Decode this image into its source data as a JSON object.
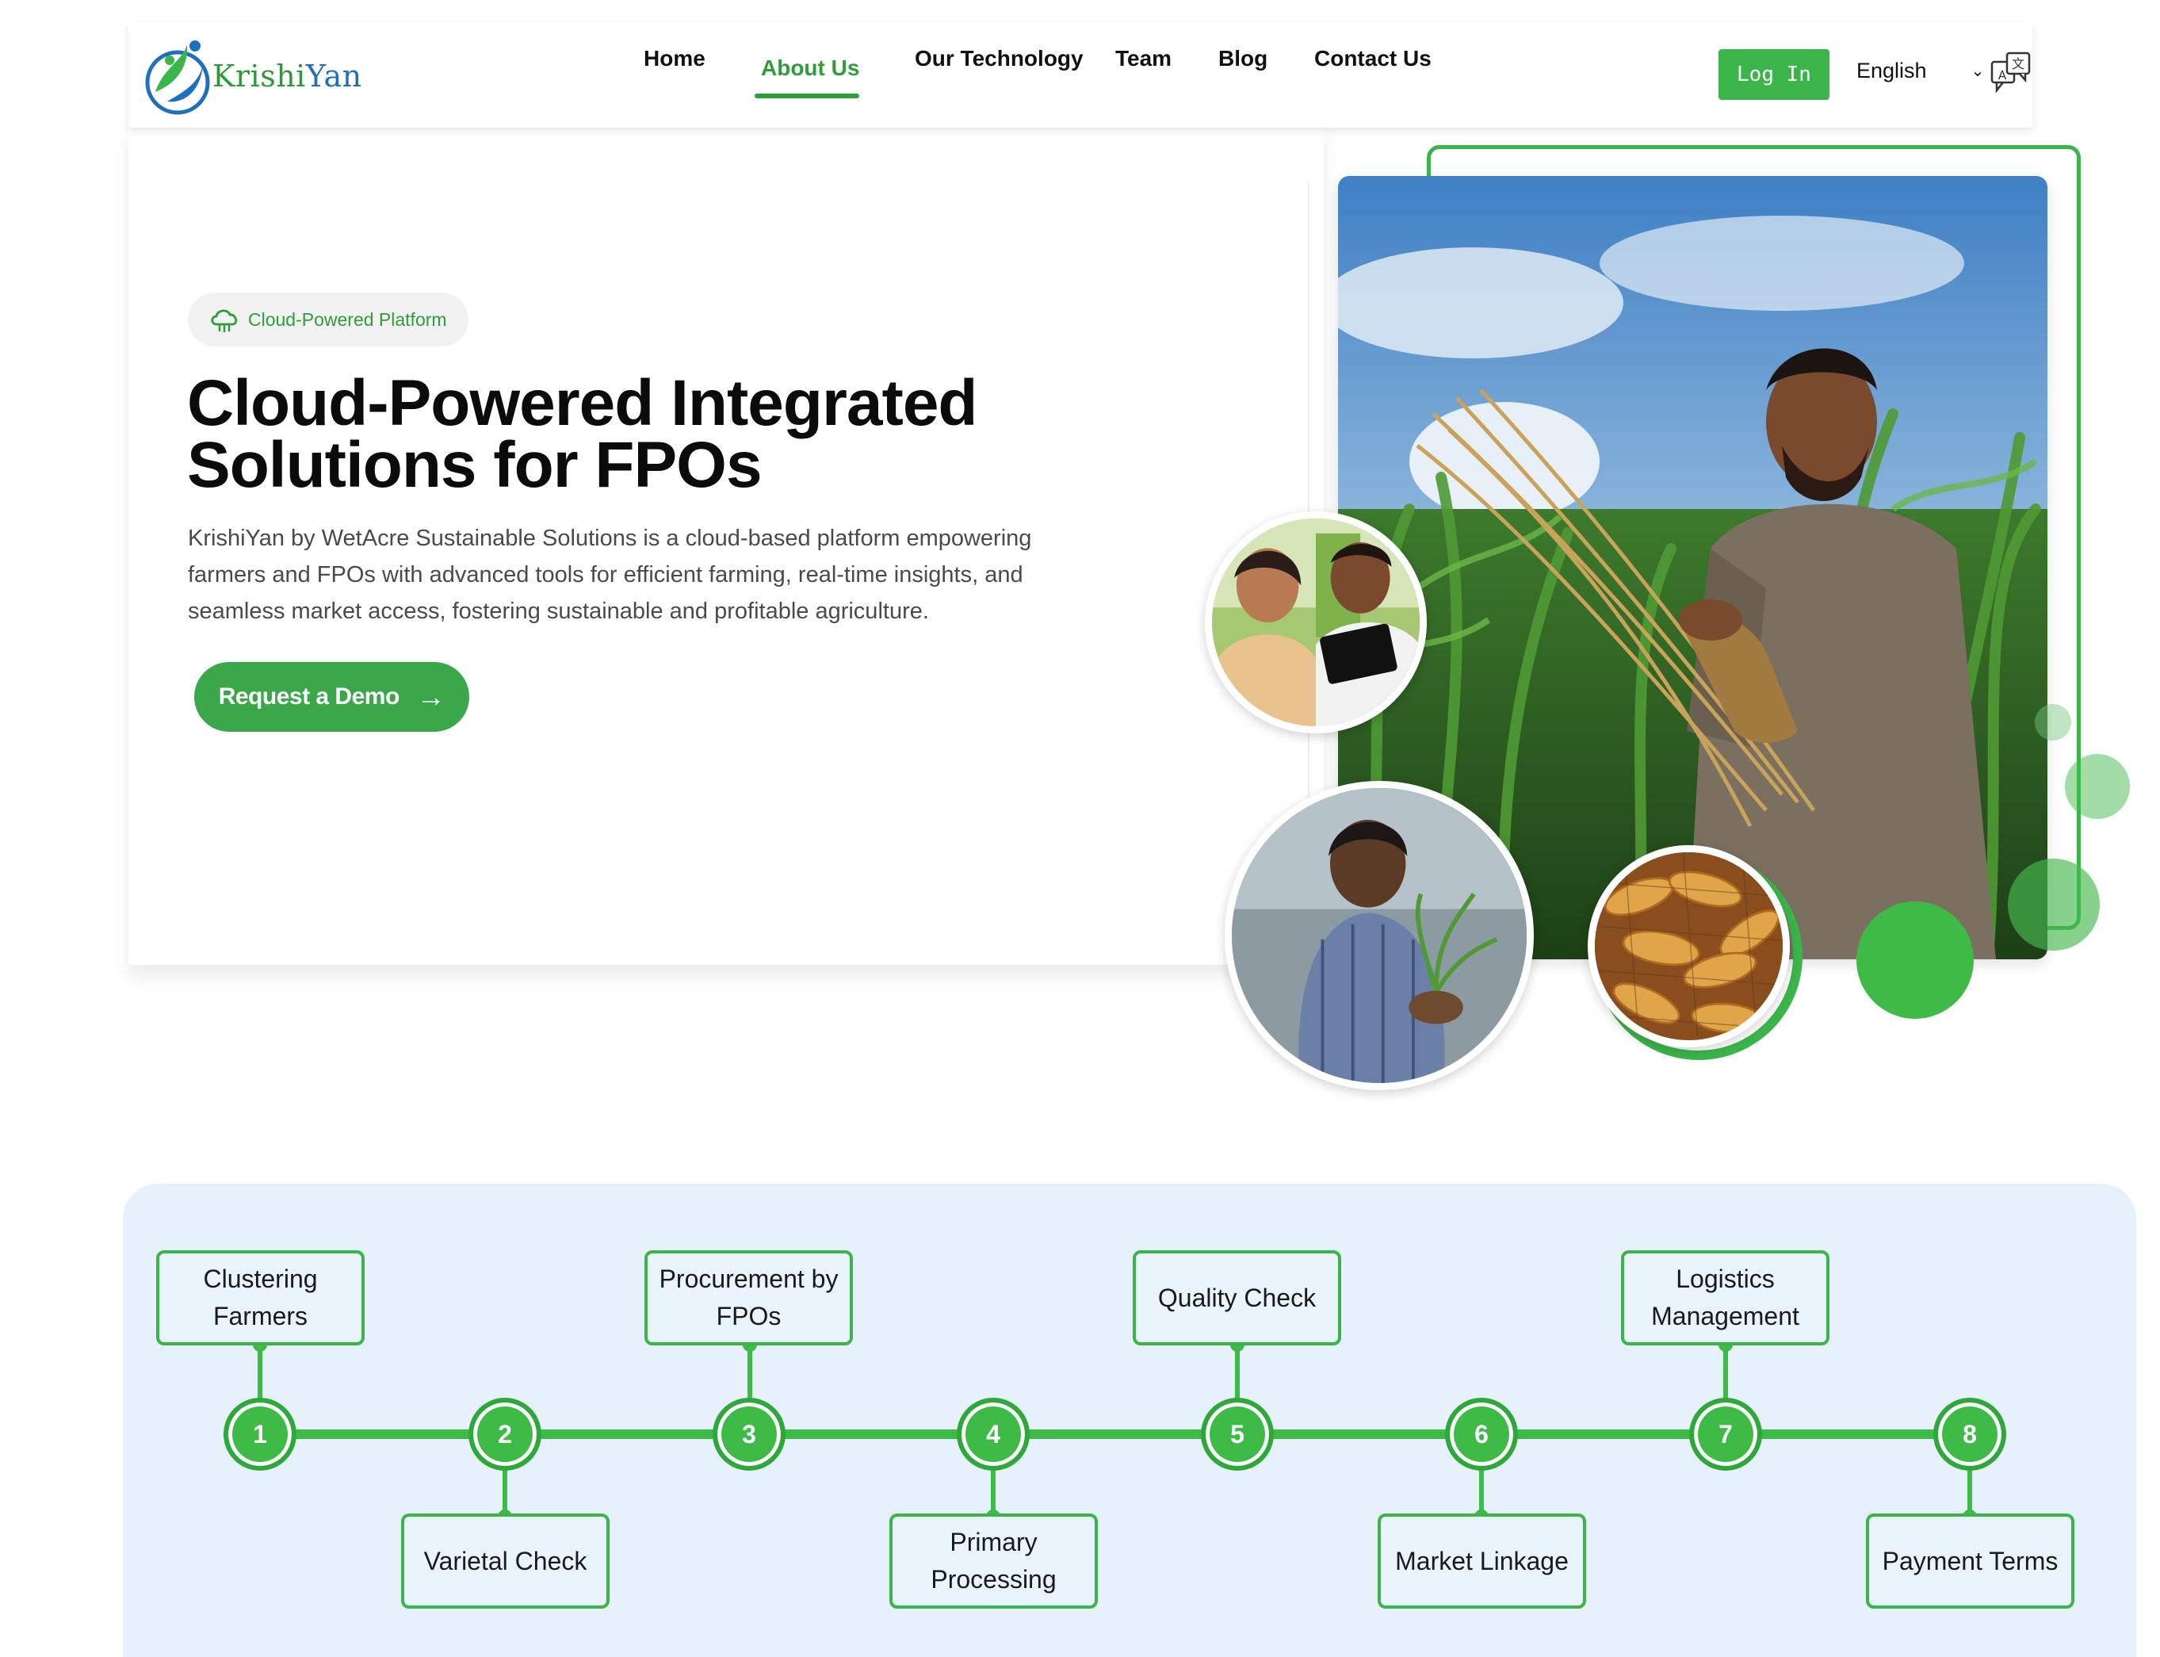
{
  "brand": {
    "name_part1": "Krishi",
    "name_part2": "Yan",
    "colors": {
      "green": "#3bb54a",
      "blue": "#1f6fc0",
      "timeline_bg": "#e7f1fb"
    }
  },
  "nav": {
    "items": [
      {
        "label": "Home",
        "active": false
      },
      {
        "label": "About Us",
        "active": true
      },
      {
        "label": "Our Technology",
        "active": false
      },
      {
        "label": "Team",
        "active": false
      },
      {
        "label": "Blog",
        "active": false
      },
      {
        "label": "Contact Us",
        "active": false
      }
    ],
    "login_label": "Log In",
    "language": "English",
    "icons": {
      "chevron": "chevron-down-icon",
      "translate": "translate-icon"
    }
  },
  "hero": {
    "badge": {
      "icon": "cloud-icon",
      "label": "Cloud-Powered Platform"
    },
    "title_line1": "Cloud-Powered Integrated",
    "title_line2": "Solutions for FPOs",
    "description": "KrishiYan by WetAcre Sustainable Solutions is a cloud-based platform empowering farmers and FPOs with advanced tools for efficient farming, real-time insights, and seamless market access, fostering sustainable and profitable agriculture.",
    "cta_label": "Request a Demo",
    "cta_arrow": "→"
  },
  "process": {
    "steps": [
      {
        "number": "1",
        "label": "Clustering Farmers"
      },
      {
        "number": "2",
        "label": "Varietal Check"
      },
      {
        "number": "3",
        "label": "Procurement by FPOs"
      },
      {
        "number": "4",
        "label": "Primary Processing"
      },
      {
        "number": "5",
        "label": "Quality Check"
      },
      {
        "number": "6",
        "label": "Market Linkage"
      },
      {
        "number": "7",
        "label": "Logistics Management"
      },
      {
        "number": "8",
        "label": "Payment Terms"
      }
    ]
  }
}
